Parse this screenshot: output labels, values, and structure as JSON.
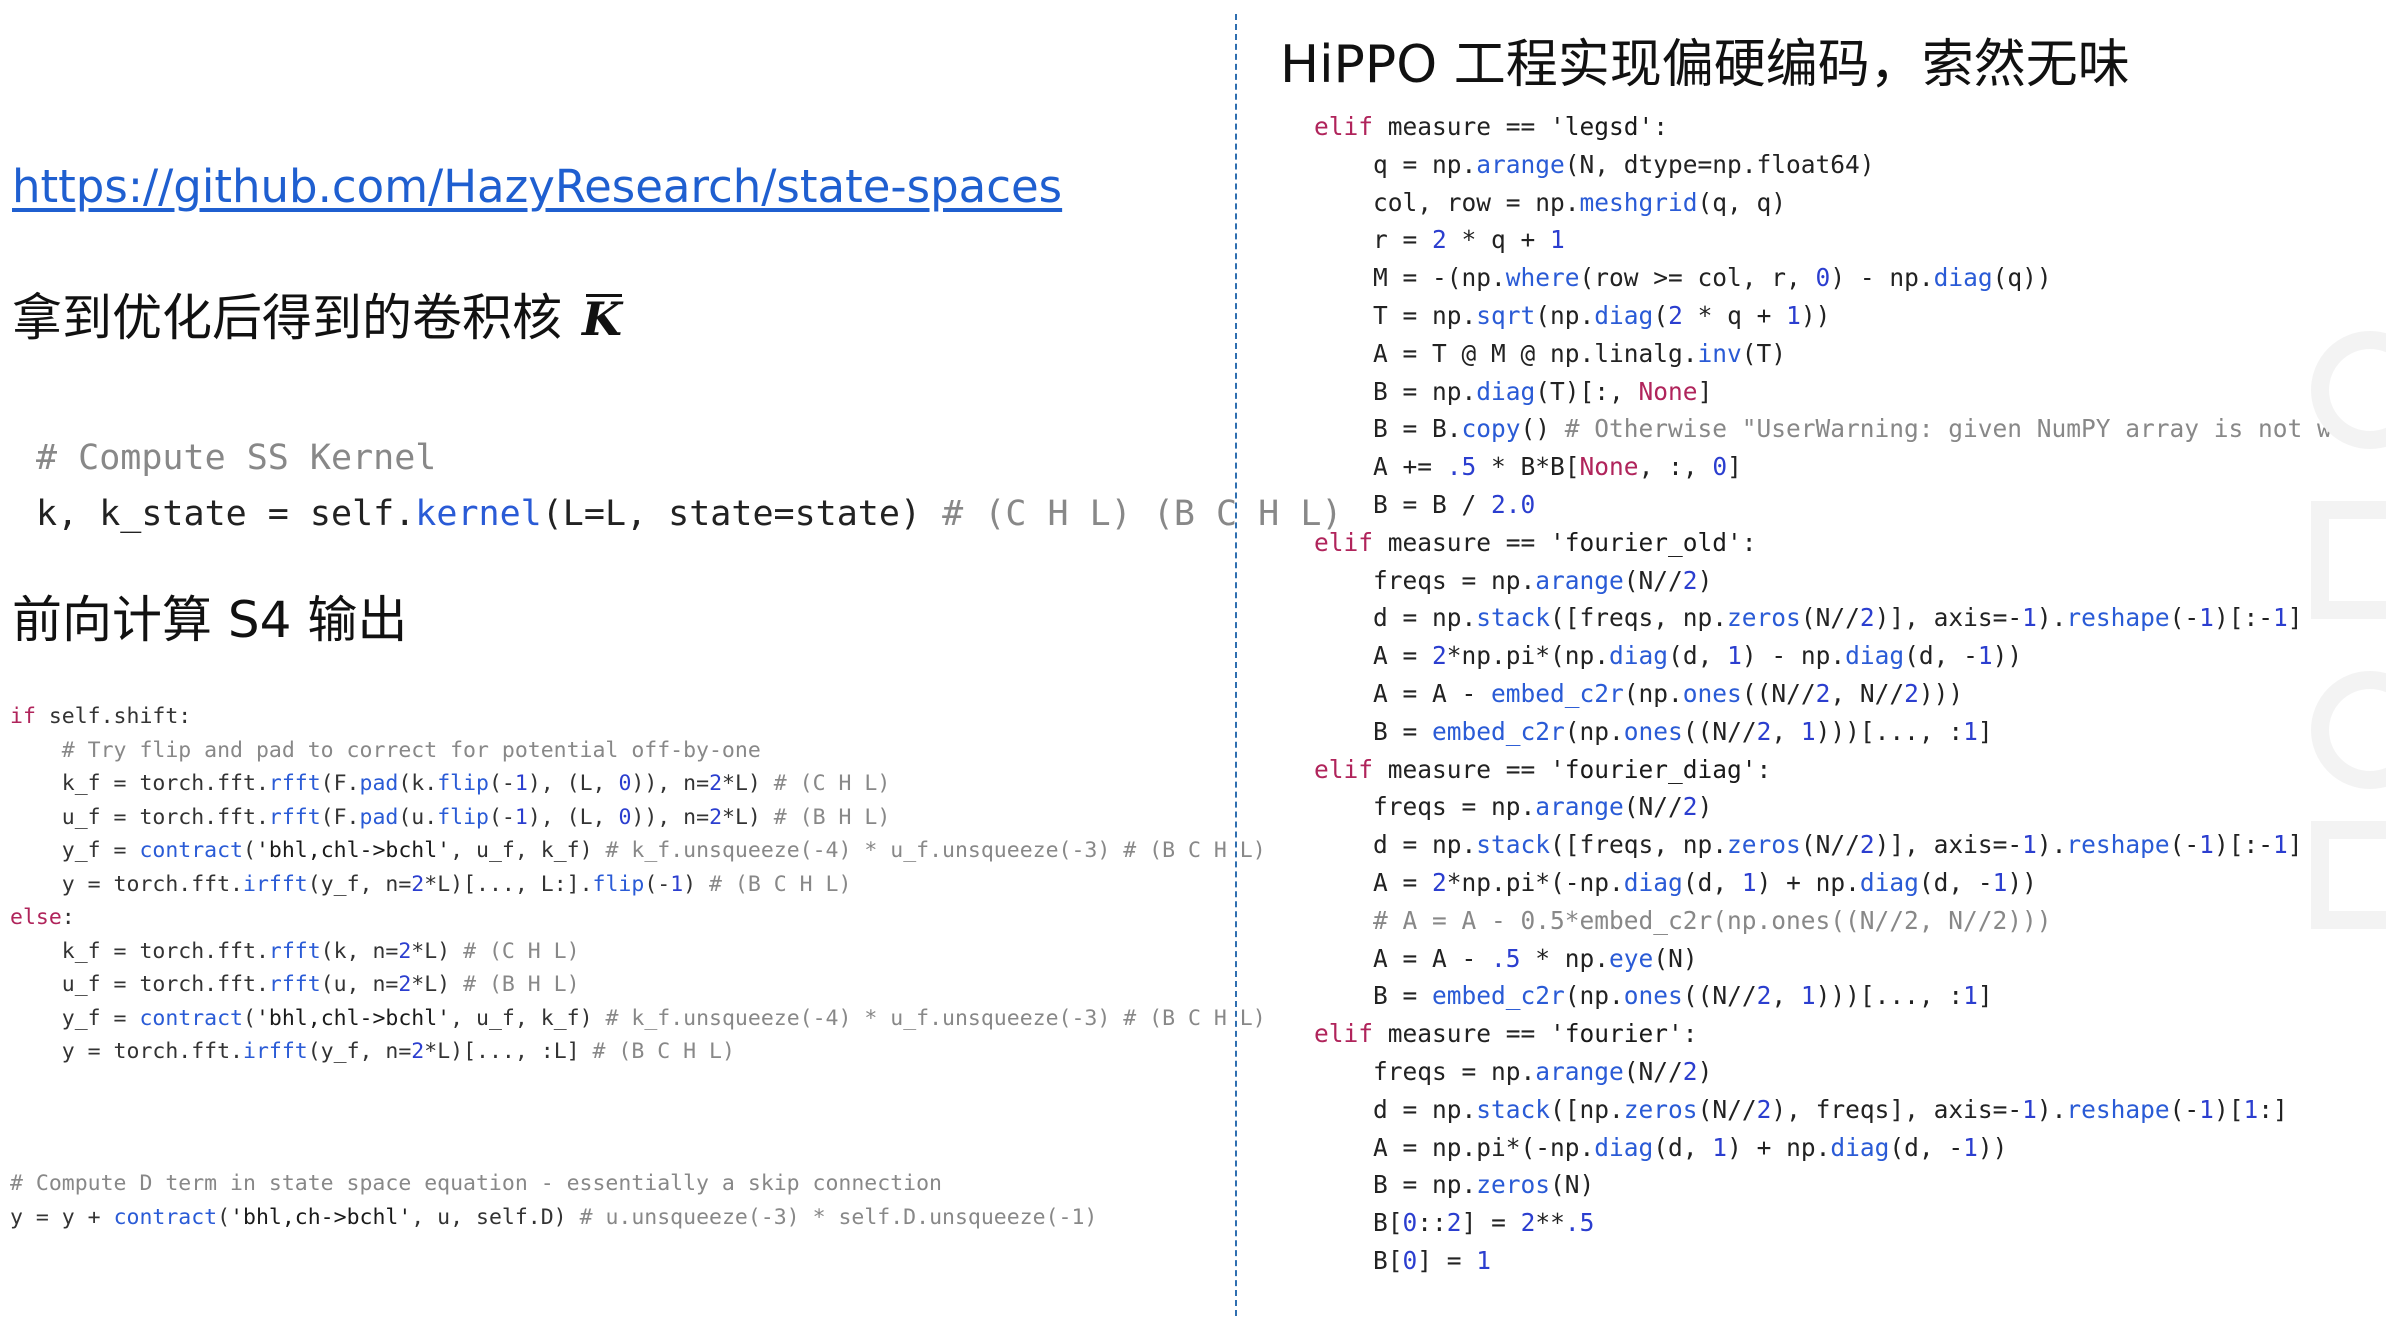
{
  "left": {
    "link": "https://github.com/HazyResearch/state-spaces",
    "heading_kernel": "拿到优化后得到的卷积核",
    "kernel_symbol": "K",
    "kernel_snippet": [
      "# Compute SS Kernel",
      "k, k_state = self.kernel(L=L, state=state) # (C H L) (B C H L)"
    ],
    "heading_forward": "前向计算 S4 输出",
    "forward_snippet": [
      "if self.shift:",
      "    # Try flip and pad to correct for potential off-by-one",
      "    k_f = torch.fft.rfft(F.pad(k.flip(-1), (L, 0)), n=2*L) # (C H L)",
      "    u_f = torch.fft.rfft(F.pad(u.flip(-1), (L, 0)), n=2*L) # (B H L)",
      "    y_f = contract('bhl,chl->bchl', u_f, k_f) # k_f.unsqueeze(-4) * u_f.unsqueeze(-3) # (B C H L)",
      "    y = torch.fft.irfft(y_f, n=2*L)[..., L:].flip(-1) # (B C H L)",
      "else:",
      "    k_f = torch.fft.rfft(k, n=2*L) # (C H L)",
      "    u_f = torch.fft.rfft(u, n=2*L) # (B H L)",
      "    y_f = contract('bhl,chl->bchl', u_f, k_f) # k_f.unsqueeze(-4) * u_f.unsqueeze(-3) # (B C H L)",
      "    y = torch.fft.irfft(y_f, n=2*L)[..., :L] # (B C H L)"
    ],
    "dterm_snippet": [
      "# Compute D term in state space equation - essentially a skip connection",
      "y = y + contract('bhl,ch->bchl', u, self.D) # u.unsqueeze(-3) * self.D.unsqueeze(-1)"
    ]
  },
  "right": {
    "title": "HiPPO 工程实现偏硬编码，索然无味",
    "hippo_snippet": [
      "elif measure == 'legsd':",
      "    q = np.arange(N, dtype=np.float64)",
      "    col, row = np.meshgrid(q, q)",
      "    r = 2 * q + 1",
      "    M = -(np.where(row >= col, r, 0) - np.diag(q))",
      "    T = np.sqrt(np.diag(2 * q + 1))",
      "    A = T @ M @ np.linalg.inv(T)",
      "    B = np.diag(T)[:, None]",
      "    B = B.copy() # Otherwise \"UserWarning: given NumPY array is not wr",
      "    A += .5 * B*B[None, :, 0]",
      "    B = B / 2.0",
      "elif measure == 'fourier_old':",
      "    freqs = np.arange(N//2)",
      "    d = np.stack([freqs, np.zeros(N//2)], axis=-1).reshape(-1)[:-1]",
      "    A = 2*np.pi*(np.diag(d, 1) - np.diag(d, -1))",
      "    A = A - embed_c2r(np.ones((N//2, N//2)))",
      "    B = embed_c2r(np.ones((N//2, 1)))[..., :1]",
      "elif measure == 'fourier_diag':",
      "    freqs = np.arange(N//2)",
      "    d = np.stack([freqs, np.zeros(N//2)], axis=-1).reshape(-1)[:-1]",
      "    A = 2*np.pi*(-np.diag(d, 1) + np.diag(d, -1))",
      "    # A = A - 0.5*embed_c2r(np.ones((N//2, N//2)))",
      "    A = A - .5 * np.eye(N)",
      "    B = embed_c2r(np.ones((N//2, 1)))[..., :1]",
      "elif measure == 'fourier':",
      "    freqs = np.arange(N//2)",
      "    d = np.stack([np.zeros(N//2), freqs], axis=-1).reshape(-1)[1:]",
      "    A = np.pi*(-np.diag(d, 1) + np.diag(d, -1))",
      "    B = np.zeros(N)",
      "    B[0::2] = 2**.5",
      "    B[0] = 1"
    ]
  },
  "colors": {
    "link": "#1f5fd0",
    "divider": "#2f6fb0",
    "keyword": "#b0245b",
    "function": "#2a5bd6",
    "comment": "#888888"
  }
}
